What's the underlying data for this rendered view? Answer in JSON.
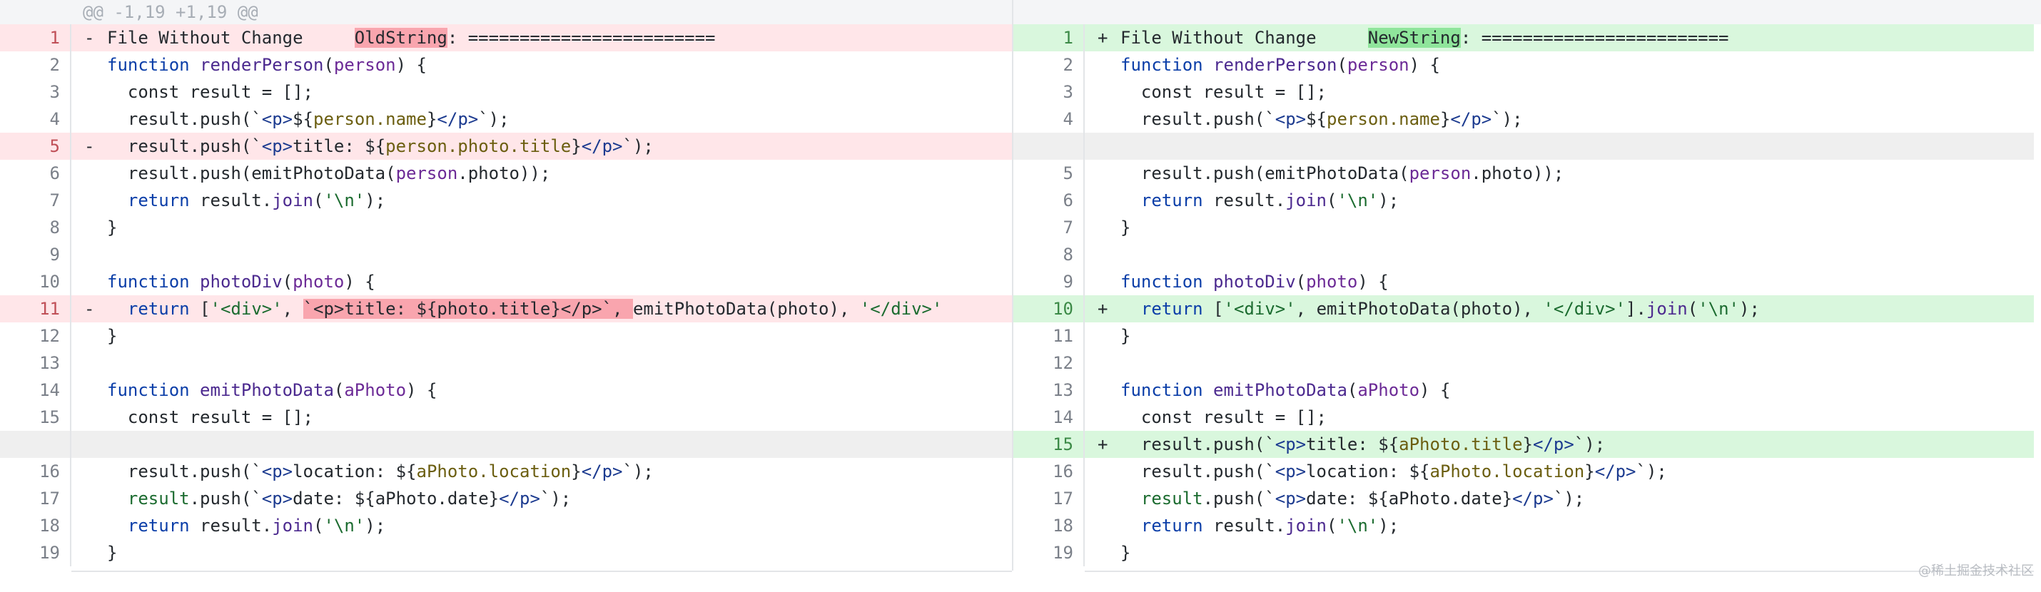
{
  "hunk_header": "@@ -1,19 +1,19 @@",
  "watermark": "@稀土掘金技术社区",
  "colors": {
    "deleted_bg": "#ffe6e9",
    "deleted_highlight": "#f9a5ae",
    "added_bg": "#d9f7dd",
    "added_highlight": "#8fe59b",
    "empty_bg": "#efefef"
  },
  "left": [
    {
      "num": "1",
      "type": "del",
      "marker": "-",
      "parts": [
        [
          "File Without Change     ",
          ""
        ],
        [
          "OldString",
          "hl-del"
        ],
        [
          ": ========================",
          ""
        ]
      ]
    },
    {
      "num": "2",
      "type": "ctx",
      "marker": "",
      "parts": [
        [
          "function ",
          "kw"
        ],
        [
          "renderPerson",
          "fn"
        ],
        [
          "(",
          ""
        ],
        [
          "person",
          "pr"
        ],
        [
          ") {",
          ""
        ]
      ]
    },
    {
      "num": "3",
      "type": "ctx",
      "marker": "",
      "parts": [
        [
          "  const result = [];",
          ""
        ]
      ]
    },
    {
      "num": "4",
      "type": "ctx",
      "marker": "",
      "parts": [
        [
          "  result.push(`",
          ""
        ],
        [
          "<p>",
          "tag"
        ],
        [
          "${",
          ""
        ],
        [
          "person.name",
          "tpl"
        ],
        [
          "}",
          ""
        ],
        [
          "</p>",
          "tag"
        ],
        [
          "`);",
          ""
        ]
      ]
    },
    {
      "num": "5",
      "type": "del",
      "marker": "-",
      "parts": [
        [
          "  result.push(`",
          ""
        ],
        [
          "<p>",
          "tag"
        ],
        [
          "title: ${",
          ""
        ],
        [
          "person.photo.title",
          "tpl"
        ],
        [
          "}",
          ""
        ],
        [
          "</p>",
          "tag"
        ],
        [
          "`);",
          ""
        ]
      ]
    },
    {
      "num": "6",
      "type": "ctx",
      "marker": "",
      "parts": [
        [
          "  result.push(emitPhotoData(",
          ""
        ],
        [
          "person",
          "pr"
        ],
        [
          ".photo));",
          ""
        ]
      ]
    },
    {
      "num": "7",
      "type": "ctx",
      "marker": "",
      "parts": [
        [
          "  ",
          ""
        ],
        [
          "return",
          "kw"
        ],
        [
          " result.",
          ""
        ],
        [
          "join",
          "fn"
        ],
        [
          "(",
          ""
        ],
        [
          "'\\n'",
          "str"
        ],
        [
          ");",
          ""
        ]
      ]
    },
    {
      "num": "8",
      "type": "ctx",
      "marker": "",
      "parts": [
        [
          "}",
          ""
        ]
      ]
    },
    {
      "num": "9",
      "type": "ctx",
      "marker": "",
      "parts": [
        [
          "",
          ""
        ]
      ]
    },
    {
      "num": "10",
      "type": "ctx",
      "marker": "",
      "parts": [
        [
          "function ",
          "kw"
        ],
        [
          "photoDiv",
          "fn"
        ],
        [
          "(",
          ""
        ],
        [
          "photo",
          "pr"
        ],
        [
          ") {",
          ""
        ]
      ]
    },
    {
      "num": "11",
      "type": "del",
      "marker": "-",
      "parts": [
        [
          "  ",
          ""
        ],
        [
          "return",
          "kw"
        ],
        [
          " [",
          ""
        ],
        [
          "'<div>'",
          "str"
        ],
        [
          ", ",
          ""
        ],
        [
          "`<p>title: ${photo.title}</p>`, ",
          "hl-del"
        ],
        [
          "emitPhotoData(photo), ",
          ""
        ],
        [
          "'</div>'",
          "str"
        ]
      ]
    },
    {
      "num": "12",
      "type": "ctx",
      "marker": "",
      "parts": [
        [
          "}",
          ""
        ]
      ]
    },
    {
      "num": "13",
      "type": "ctx",
      "marker": "",
      "parts": [
        [
          "",
          ""
        ]
      ]
    },
    {
      "num": "14",
      "type": "ctx",
      "marker": "",
      "parts": [
        [
          "function ",
          "kw"
        ],
        [
          "emitPhotoData",
          "fn"
        ],
        [
          "(",
          ""
        ],
        [
          "aPhoto",
          "pr"
        ],
        [
          ") {",
          ""
        ]
      ]
    },
    {
      "num": "15",
      "type": "ctx",
      "marker": "",
      "parts": [
        [
          "  const result = [];",
          ""
        ]
      ]
    },
    {
      "num": "",
      "type": "empty",
      "marker": "",
      "parts": []
    },
    {
      "num": "16",
      "type": "ctx",
      "marker": "",
      "parts": [
        [
          "  result.push(`",
          ""
        ],
        [
          "<p>",
          "tag"
        ],
        [
          "location: ${",
          ""
        ],
        [
          "aPhoto.location",
          "tpl"
        ],
        [
          "}",
          ""
        ],
        [
          "</p>",
          "tag"
        ],
        [
          "`);",
          ""
        ]
      ]
    },
    {
      "num": "17",
      "type": "ctx",
      "marker": "",
      "parts": [
        [
          "  ",
          ""
        ],
        [
          "result",
          "str"
        ],
        [
          ".push(`",
          ""
        ],
        [
          "<p>",
          "tag"
        ],
        [
          "date: ${aPhoto.date}",
          ""
        ],
        [
          "</p>",
          "tag"
        ],
        [
          "`);",
          ""
        ]
      ]
    },
    {
      "num": "18",
      "type": "ctx",
      "marker": "",
      "parts": [
        [
          "  ",
          ""
        ],
        [
          "return",
          "kw"
        ],
        [
          " result.",
          ""
        ],
        [
          "join",
          "fn"
        ],
        [
          "(",
          ""
        ],
        [
          "'\\n'",
          "str"
        ],
        [
          ");",
          ""
        ]
      ]
    },
    {
      "num": "19",
      "type": "ctx",
      "marker": "",
      "parts": [
        [
          "}",
          ""
        ]
      ]
    }
  ],
  "right": [
    {
      "num": "1",
      "type": "add",
      "marker": "+",
      "parts": [
        [
          "File Without Change     ",
          ""
        ],
        [
          "NewString",
          "hl-add"
        ],
        [
          ": ========================",
          ""
        ]
      ]
    },
    {
      "num": "2",
      "type": "ctx",
      "marker": "",
      "parts": [
        [
          "function ",
          "kw"
        ],
        [
          "renderPerson",
          "fn"
        ],
        [
          "(",
          ""
        ],
        [
          "person",
          "pr"
        ],
        [
          ") {",
          ""
        ]
      ]
    },
    {
      "num": "3",
      "type": "ctx",
      "marker": "",
      "parts": [
        [
          "  const result = [];",
          ""
        ]
      ]
    },
    {
      "num": "4",
      "type": "ctx",
      "marker": "",
      "parts": [
        [
          "  result.push(`",
          ""
        ],
        [
          "<p>",
          "tag"
        ],
        [
          "${",
          ""
        ],
        [
          "person.name",
          "tpl"
        ],
        [
          "}",
          ""
        ],
        [
          "</p>",
          "tag"
        ],
        [
          "`);",
          ""
        ]
      ]
    },
    {
      "num": "",
      "type": "empty",
      "marker": "",
      "parts": []
    },
    {
      "num": "5",
      "type": "ctx",
      "marker": "",
      "parts": [
        [
          "  result.push(emitPhotoData(",
          ""
        ],
        [
          "person",
          "pr"
        ],
        [
          ".photo));",
          ""
        ]
      ]
    },
    {
      "num": "6",
      "type": "ctx",
      "marker": "",
      "parts": [
        [
          "  ",
          ""
        ],
        [
          "return",
          "kw"
        ],
        [
          " result.",
          ""
        ],
        [
          "join",
          "fn"
        ],
        [
          "(",
          ""
        ],
        [
          "'\\n'",
          "str"
        ],
        [
          ");",
          ""
        ]
      ]
    },
    {
      "num": "7",
      "type": "ctx",
      "marker": "",
      "parts": [
        [
          "}",
          ""
        ]
      ]
    },
    {
      "num": "8",
      "type": "ctx",
      "marker": "",
      "parts": [
        [
          "",
          ""
        ]
      ]
    },
    {
      "num": "9",
      "type": "ctx",
      "marker": "",
      "parts": [
        [
          "function ",
          "kw"
        ],
        [
          "photoDiv",
          "fn"
        ],
        [
          "(",
          ""
        ],
        [
          "photo",
          "pr"
        ],
        [
          ") {",
          ""
        ]
      ]
    },
    {
      "num": "10",
      "type": "add",
      "marker": "+",
      "parts": [
        [
          "  ",
          ""
        ],
        [
          "return",
          "kw"
        ],
        [
          " [",
          ""
        ],
        [
          "'<div>'",
          "str"
        ],
        [
          ", emitPhotoData(photo), ",
          ""
        ],
        [
          "'</div>'",
          "str"
        ],
        [
          "].",
          ""
        ],
        [
          "join",
          "fn"
        ],
        [
          "(",
          ""
        ],
        [
          "'\\n'",
          "str"
        ],
        [
          ");",
          ""
        ]
      ]
    },
    {
      "num": "11",
      "type": "ctx",
      "marker": "",
      "parts": [
        [
          "}",
          ""
        ]
      ]
    },
    {
      "num": "12",
      "type": "ctx",
      "marker": "",
      "parts": [
        [
          "",
          ""
        ]
      ]
    },
    {
      "num": "13",
      "type": "ctx",
      "marker": "",
      "parts": [
        [
          "function ",
          "kw"
        ],
        [
          "emitPhotoData",
          "fn"
        ],
        [
          "(",
          ""
        ],
        [
          "aPhoto",
          "pr"
        ],
        [
          ") {",
          ""
        ]
      ]
    },
    {
      "num": "14",
      "type": "ctx",
      "marker": "",
      "parts": [
        [
          "  const result = [];",
          ""
        ]
      ]
    },
    {
      "num": "15",
      "type": "add",
      "marker": "+",
      "parts": [
        [
          "  result.push(`",
          ""
        ],
        [
          "<p>",
          "tag"
        ],
        [
          "title: ${",
          ""
        ],
        [
          "aPhoto.title",
          "tpl"
        ],
        [
          "}",
          ""
        ],
        [
          "</p>",
          "tag"
        ],
        [
          "`);",
          ""
        ]
      ]
    },
    {
      "num": "16",
      "type": "ctx",
      "marker": "",
      "parts": [
        [
          "  result.push(`",
          ""
        ],
        [
          "<p>",
          "tag"
        ],
        [
          "location: ${",
          ""
        ],
        [
          "aPhoto.location",
          "tpl"
        ],
        [
          "}",
          ""
        ],
        [
          "</p>",
          "tag"
        ],
        [
          "`);",
          ""
        ]
      ]
    },
    {
      "num": "17",
      "type": "ctx",
      "marker": "",
      "parts": [
        [
          "  ",
          ""
        ],
        [
          "result",
          "str"
        ],
        [
          ".push(`",
          ""
        ],
        [
          "<p>",
          "tag"
        ],
        [
          "date: ${aPhoto.date}",
          ""
        ],
        [
          "</p>",
          "tag"
        ],
        [
          "`);",
          ""
        ]
      ]
    },
    {
      "num": "18",
      "type": "ctx",
      "marker": "",
      "parts": [
        [
          "  ",
          ""
        ],
        [
          "return",
          "kw"
        ],
        [
          " result.",
          ""
        ],
        [
          "join",
          "fn"
        ],
        [
          "(",
          ""
        ],
        [
          "'\\n'",
          "str"
        ],
        [
          ");",
          ""
        ]
      ]
    },
    {
      "num": "19",
      "type": "ctx",
      "marker": "",
      "parts": [
        [
          "}",
          ""
        ]
      ]
    }
  ]
}
